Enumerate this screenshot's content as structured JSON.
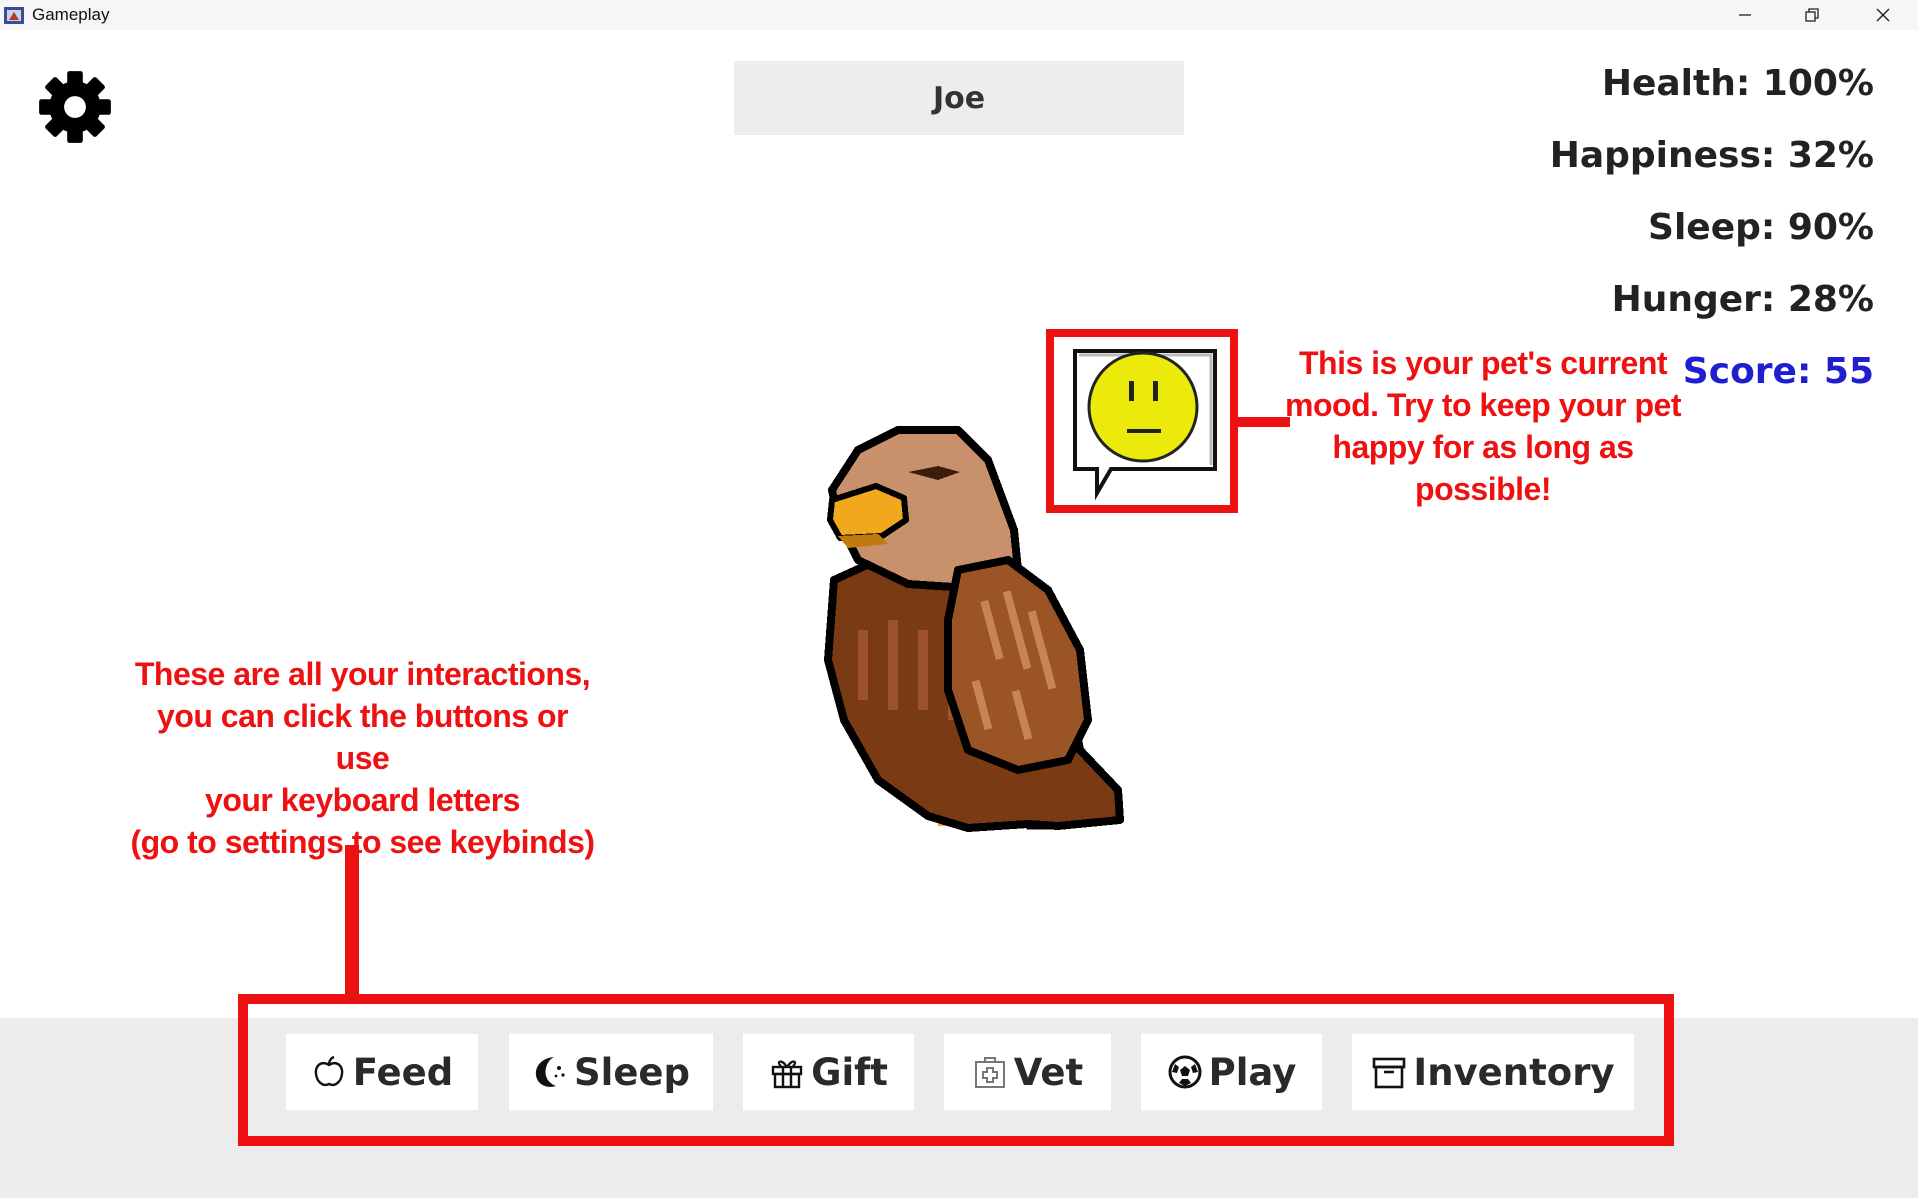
{
  "window": {
    "title": "Gameplay"
  },
  "pet": {
    "name": "Joe"
  },
  "stats": {
    "health": "Health: 100%",
    "happiness": "Happiness: 32%",
    "sleep": "Sleep: 90%",
    "hunger": "Hunger: 28%",
    "score": "Score: 55",
    "score_color": "#1f1fcf"
  },
  "mood": {
    "icon": "neutral-face-icon",
    "annotation_lines": [
      "This is your pet's current",
      "mood. Try to keep your pet",
      "happy for as long as",
      "possible!"
    ]
  },
  "interactions": {
    "annotation_lines": [
      "These are all your interactions,",
      "you can click the buttons or use",
      "your keyboard letters",
      "(go to settings to see keybinds)"
    ],
    "buttons": [
      {
        "label": "Feed",
        "icon": "apple-icon"
      },
      {
        "label": "Sleep",
        "icon": "moon-icon"
      },
      {
        "label": "Gift",
        "icon": "gift-icon"
      },
      {
        "label": "Vet",
        "icon": "medkit-icon"
      },
      {
        "label": "Play",
        "icon": "soccer-ball-icon"
      },
      {
        "label": "Inventory",
        "icon": "box-icon"
      }
    ]
  },
  "colors": {
    "annotation": "#ee1111",
    "action_bar": "#ececec",
    "name_field": "#ededed"
  }
}
